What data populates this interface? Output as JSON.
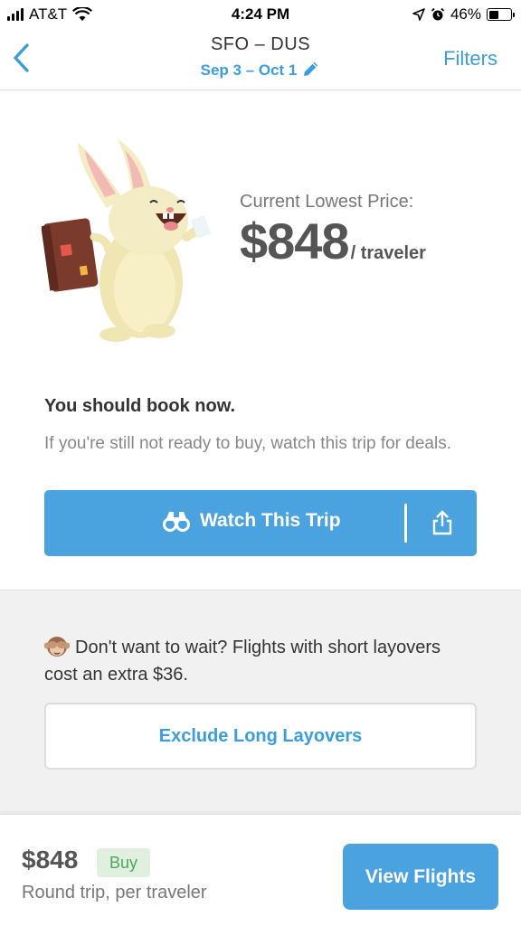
{
  "status_bar": {
    "carrier": "AT&T",
    "time": "4:24 PM",
    "battery_percent": "46%",
    "battery_level": 0.46,
    "icons": [
      "signal-icon",
      "wifi-icon",
      "location-icon",
      "alarm-icon",
      "battery-icon"
    ]
  },
  "header": {
    "route": "SFO – DUS",
    "dates": "Sep 3 – Oct 1",
    "filters_label": "Filters",
    "back_icon": "chevron-left-icon",
    "edit_icon": "pencil-icon"
  },
  "hero": {
    "price_label": "Current Lowest Price:",
    "price": "$848",
    "price_unit": "/ traveler",
    "illustration": "bunny-traveler-illustration"
  },
  "advice": {
    "headline": "You should book now.",
    "description": "If you're still not ready to buy, watch this trip for deals."
  },
  "watch_button": {
    "label": "Watch This Trip",
    "icon": "binoculars-icon",
    "share_icon": "share-icon"
  },
  "layover": {
    "emoji_icon": "see-no-evil-monkey-icon",
    "text": "Don't want to wait? Flights with short layovers cost an extra $36.",
    "button_label": "Exclude Long Layovers"
  },
  "bottom_bar": {
    "price": "$848",
    "badge": "Buy",
    "subtitle": "Round trip, per traveler",
    "cta_label": "View Flights"
  },
  "colors": {
    "accent": "#3b9ddb",
    "button_bg": "#4aa3df",
    "badge_bg": "#dff0df",
    "badge_text": "#4fa65a",
    "section_bg": "#f1f1f1"
  }
}
